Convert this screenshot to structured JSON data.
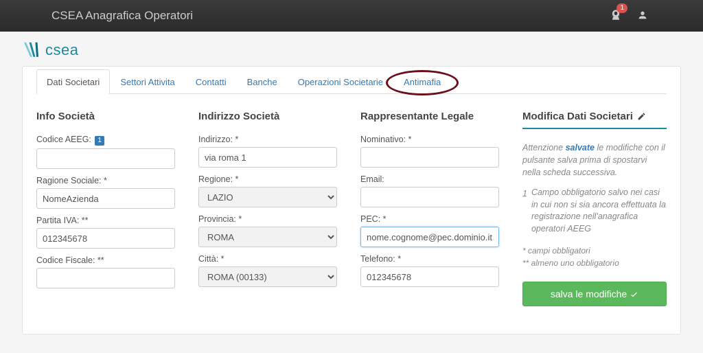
{
  "topbar": {
    "title": "CSEA Anagrafica Operatori",
    "notification_count": "1"
  },
  "logo_text": "csea",
  "tabs": [
    {
      "label": "Dati Societari",
      "active": true
    },
    {
      "label": "Settori Attivita",
      "active": false
    },
    {
      "label": "Contatti",
      "active": false
    },
    {
      "label": "Banche",
      "active": false
    },
    {
      "label": "Operazioni Societarie",
      "active": false
    },
    {
      "label": "Antimafia",
      "active": false,
      "circled": true
    }
  ],
  "info_societa": {
    "title": "Info Società",
    "codice_aeeg_label": "Codice AEEG:",
    "codice_aeeg_badge": "1",
    "codice_aeeg_value": "",
    "ragione_sociale_label": "Ragione Sociale: *",
    "ragione_sociale_value": "NomeAzienda",
    "partita_iva_label": "Partita IVA: **",
    "partita_iva_value": "012345678",
    "codice_fiscale_label": "Codice Fiscale: **",
    "codice_fiscale_value": ""
  },
  "indirizzo": {
    "title": "Indirizzo Società",
    "indirizzo_label": "Indirizzo: *",
    "indirizzo_value": "via roma 1",
    "regione_label": "Regione: *",
    "regione_value": "LAZIO",
    "provincia_label": "Provincia: *",
    "provincia_value": "ROMA",
    "citta_label": "Città: *",
    "citta_value": "ROMA (00133)"
  },
  "rappresentante": {
    "title": "Rappresentante Legale",
    "nominativo_label": "Nominativo: *",
    "nominativo_value": "",
    "email_label": "Email:",
    "email_value": "",
    "pec_label": "PEC: *",
    "pec_value": "nome.cognome@pec.dominio.it",
    "telefono_label": "Telefono: *",
    "telefono_value": "012345678"
  },
  "sidebar": {
    "title": "Modifica Dati Societari",
    "attention_prefix": "Attenzione",
    "attention_strong": "salvate",
    "attention_text": "le modifiche con il pulsante salva prima di spostarvi nella scheda successiva.",
    "note_badge": "1",
    "note_text": "Campo obbligatorio salvo nei casi in cui non si sia ancora effettuata la registrazione nell'anagrafica operatori AEEG",
    "legend1": "* campi obbligatori",
    "legend2": "** almeno uno obbligatorio",
    "save_label": "salva le modifiche"
  }
}
